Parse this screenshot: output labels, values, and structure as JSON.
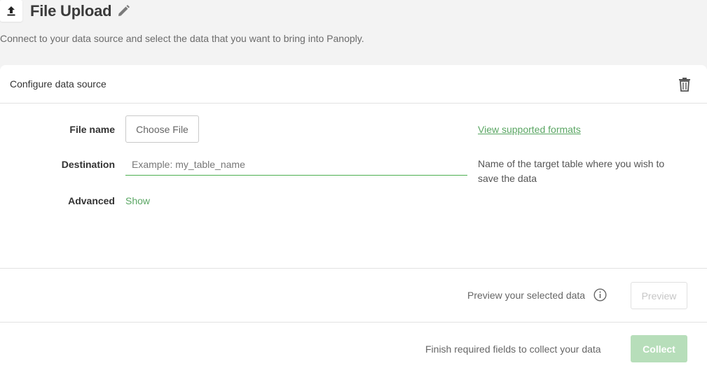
{
  "header": {
    "title": "File Upload",
    "subtitle": "Connect to your data source and select the data that you want to bring into Panoply.",
    "upload_icon": "upload-icon",
    "edit_icon": "pencil-icon"
  },
  "card": {
    "title": "Configure data source",
    "delete_icon": "trash-icon"
  },
  "form": {
    "file_name_label": "File name",
    "choose_file_label": "Choose File",
    "formats_link": "View supported formats",
    "destination_label": "Destination",
    "destination_placeholder": "Example: my_table_name",
    "destination_value": "",
    "destination_help": "Name of the target table where you wish to save the data",
    "advanced_label": "Advanced",
    "advanced_toggle": "Show"
  },
  "preview": {
    "text": "Preview your selected data",
    "info_icon": "info-icon",
    "button_label": "Preview"
  },
  "collect": {
    "text": "Finish required fields to collect your data",
    "button_label": "Collect"
  },
  "colors": {
    "accent_green": "#5aa663",
    "collect_disabled": "#b7deba",
    "background": "#f3f3f3"
  }
}
